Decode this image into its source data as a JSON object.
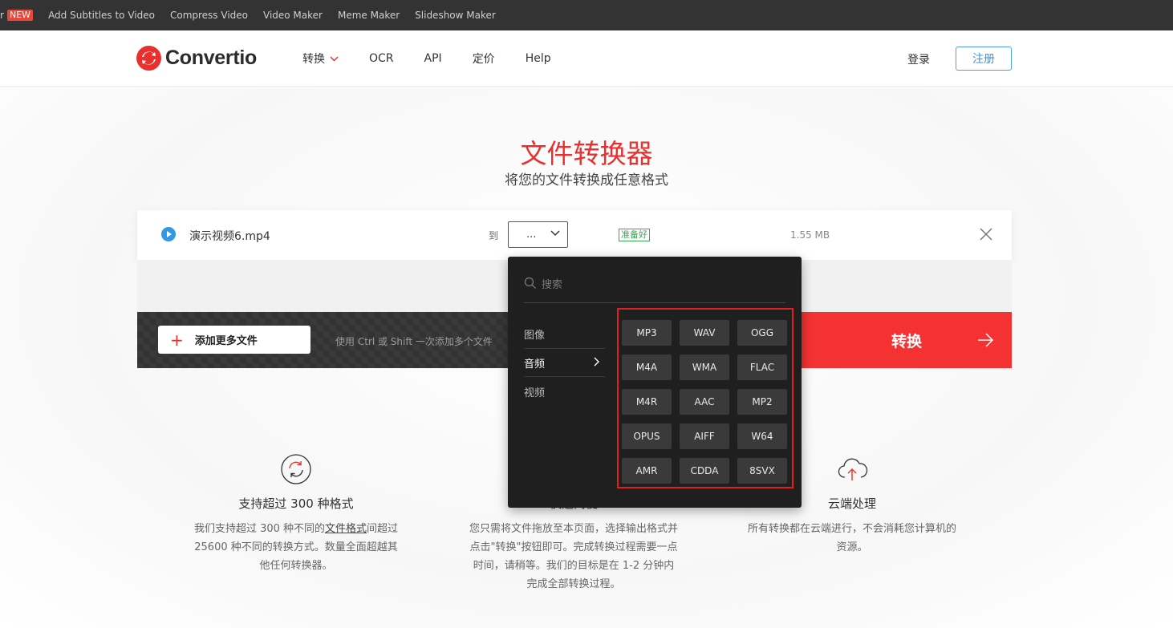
{
  "topbar": {
    "cut_text": "r",
    "new_badge": "NEW",
    "links": [
      "Add Subtitles to Video",
      "Compress Video",
      "Video Maker",
      "Meme Maker",
      "Slideshow Maker"
    ]
  },
  "header": {
    "logo": "Convertio",
    "nav": [
      "转换",
      "OCR",
      "API",
      "定价",
      "Help"
    ],
    "login": "登录",
    "register": "注册"
  },
  "hero": {
    "title": "文件转换器",
    "subtitle": "将您的文件转换成任意格式"
  },
  "file": {
    "name": "演示视频6.mp4",
    "to_label": "到",
    "format_value": "...",
    "status": "准备好",
    "size": "1.55 MB"
  },
  "actions": {
    "add_more": "添加更多文件",
    "hint": "使用 Ctrl 或 Shift 一次添加多个文件",
    "convert": "转换"
  },
  "dropdown": {
    "search_placeholder": "搜索",
    "categories": [
      "图像",
      "音频",
      "视频"
    ],
    "active_category": "音频",
    "formats": [
      "MP3",
      "WAV",
      "OGG",
      "M4A",
      "WMA",
      "FLAC",
      "M4R",
      "AAC",
      "MP2",
      "OPUS",
      "AIFF",
      "W64",
      "AMR",
      "CDDA",
      "8SVX"
    ]
  },
  "features": [
    {
      "title": "支持超过 300 种格式",
      "desc_before": "我们支持超过 300 种不同的",
      "desc_link": "文件格式",
      "desc_after": "间超过 25600 种不同的转换方式。数量全面超越其他任何转换器。"
    },
    {
      "title": "快速简便",
      "desc": "您只需将文件拖放至本页面，选择输出格式并点击\"转换\"按钮即可。完成转换过程需要一点时间，请稍等。我们的目标是在 1-2 分钟内完成全部转换过程。"
    },
    {
      "title": "云端处理",
      "desc": "所有转换都在云端进行，不会消耗您计算机的资源。"
    }
  ],
  "colors": {
    "brand_red": "#e8312e",
    "convert_red": "#f43232",
    "ready_green": "#36a852",
    "register_blue": "#3b97d3"
  }
}
